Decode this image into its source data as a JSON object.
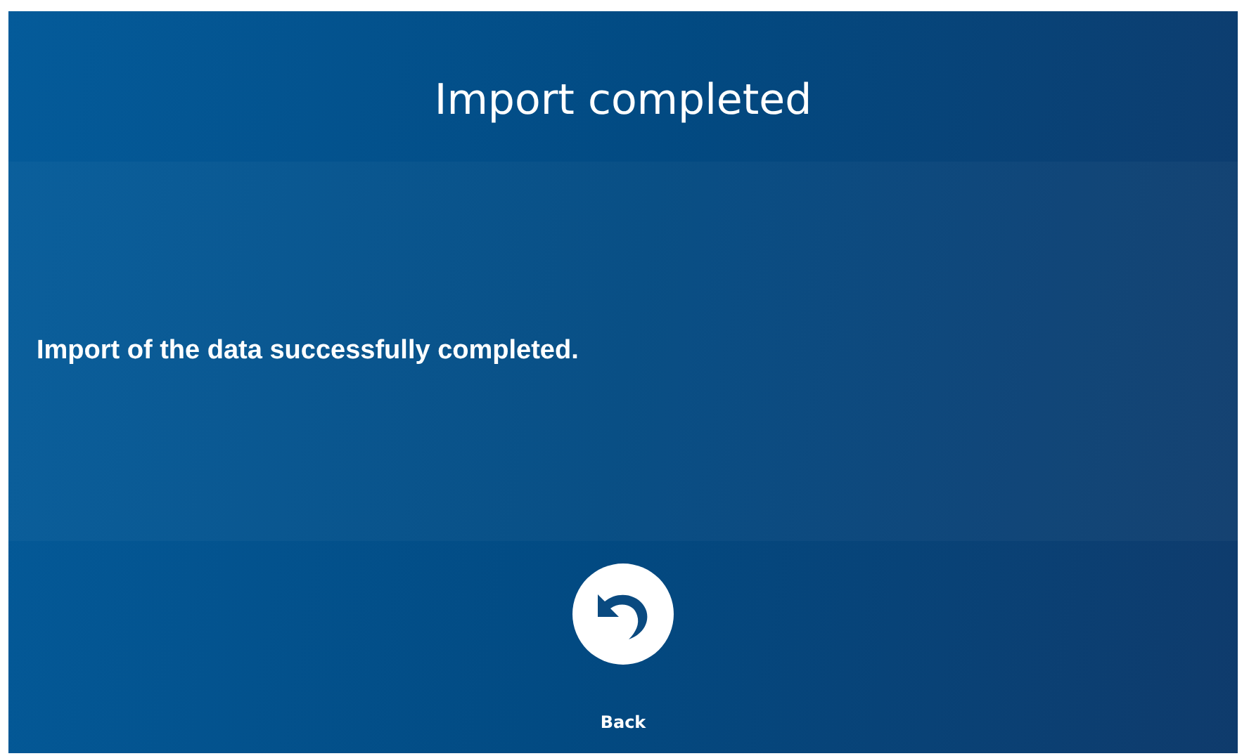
{
  "title": "Import completed",
  "message": "Import of the data successfully completed.",
  "back_button": {
    "label": "Back"
  }
}
